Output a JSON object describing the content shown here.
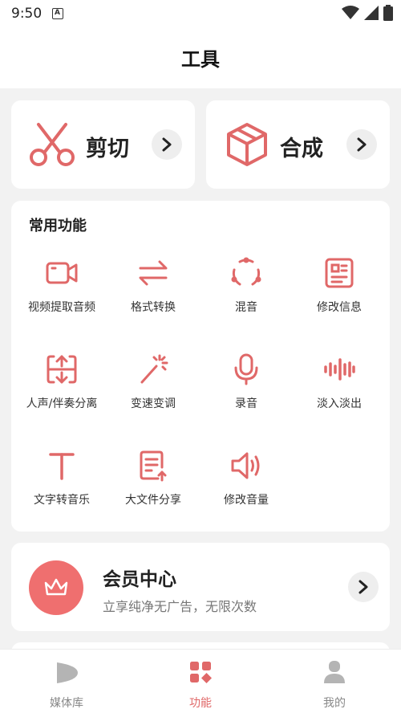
{
  "status_bar": {
    "time": "9:50",
    "notification_glyph": "A"
  },
  "header": {
    "title": "工具"
  },
  "top_cards": [
    {
      "label": "剪切",
      "icon": "scissors-icon"
    },
    {
      "label": "合成",
      "icon": "cube-icon"
    }
  ],
  "features": {
    "title": "常用功能",
    "items": [
      {
        "label": "视频提取音频",
        "icon": "video-camera-icon"
      },
      {
        "label": "格式转换",
        "icon": "swap-arrows-icon"
      },
      {
        "label": "混音",
        "icon": "mix-circle-icon"
      },
      {
        "label": "修改信息",
        "icon": "info-card-icon"
      },
      {
        "label": "人声/伴奏分离",
        "icon": "split-vertical-icon"
      },
      {
        "label": "变速变调",
        "icon": "magic-wand-icon"
      },
      {
        "label": "录音",
        "icon": "microphone-icon"
      },
      {
        "label": "淡入淡出",
        "icon": "waveform-icon"
      },
      {
        "label": "文字转音乐",
        "icon": "text-t-icon"
      },
      {
        "label": "大文件分享",
        "icon": "file-upload-icon"
      },
      {
        "label": "修改音量",
        "icon": "speaker-icon"
      }
    ]
  },
  "vip": {
    "title": "会员中心",
    "subtitle": "立享纯净无广告，无限次数",
    "icon": "crown-icon"
  },
  "tabbar": {
    "active": "功能",
    "tabs": [
      {
        "label": "媒体库",
        "icon": "play-leaf-icon"
      },
      {
        "label": "功能",
        "icon": "grid-apps-icon"
      },
      {
        "label": "我的",
        "icon": "person-icon"
      }
    ]
  },
  "colors": {
    "accent": "#E06868",
    "background": "#F2F2F2",
    "card": "#FFFFFF"
  }
}
